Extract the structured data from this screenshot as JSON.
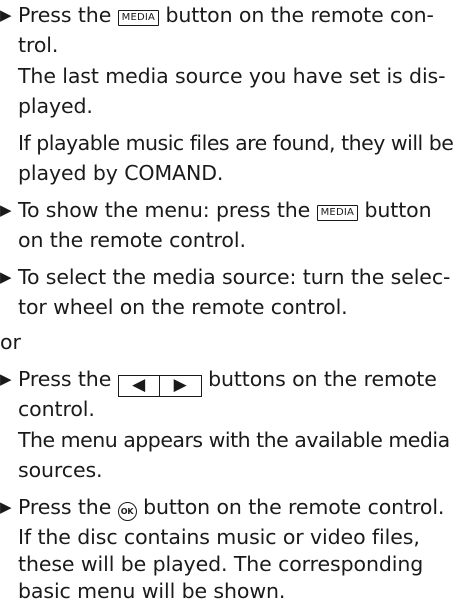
{
  "bullet_glyph": "▶",
  "keys": {
    "media": "MEDIA",
    "ok": "OK",
    "left_arrow": "◀",
    "right_arrow": "▶"
  },
  "step1": {
    "line1_pre": "Press the",
    "line1_post": "button on the remote con-",
    "line2": "trol."
  },
  "result1": {
    "line1": "The last media source you have set is dis-",
    "line2": "played."
  },
  "result2": {
    "line1": "If playable music files are found, they will be",
    "line2": "played by COMAND."
  },
  "step2": {
    "line1_pre": "To show the menu: press the",
    "line1_post": "button",
    "line2": "on the remote control."
  },
  "step3": {
    "line1": "To select the media source: turn the selec-",
    "line2": "tor wheel on the remote control."
  },
  "or_text": "or",
  "step4": {
    "line1_pre": "Press the",
    "line1_post": "buttons on the remote",
    "line2": "control."
  },
  "result4": {
    "line1": "The menu appears with the available media",
    "line2": "sources."
  },
  "step5": {
    "line1_pre": "Press the",
    "line1_post": "button on the remote control."
  },
  "result5": {
    "line1": "If the disc contains music or video files,",
    "line2": "these will be played. The corresponding",
    "line3": "basic menu will be shown."
  }
}
